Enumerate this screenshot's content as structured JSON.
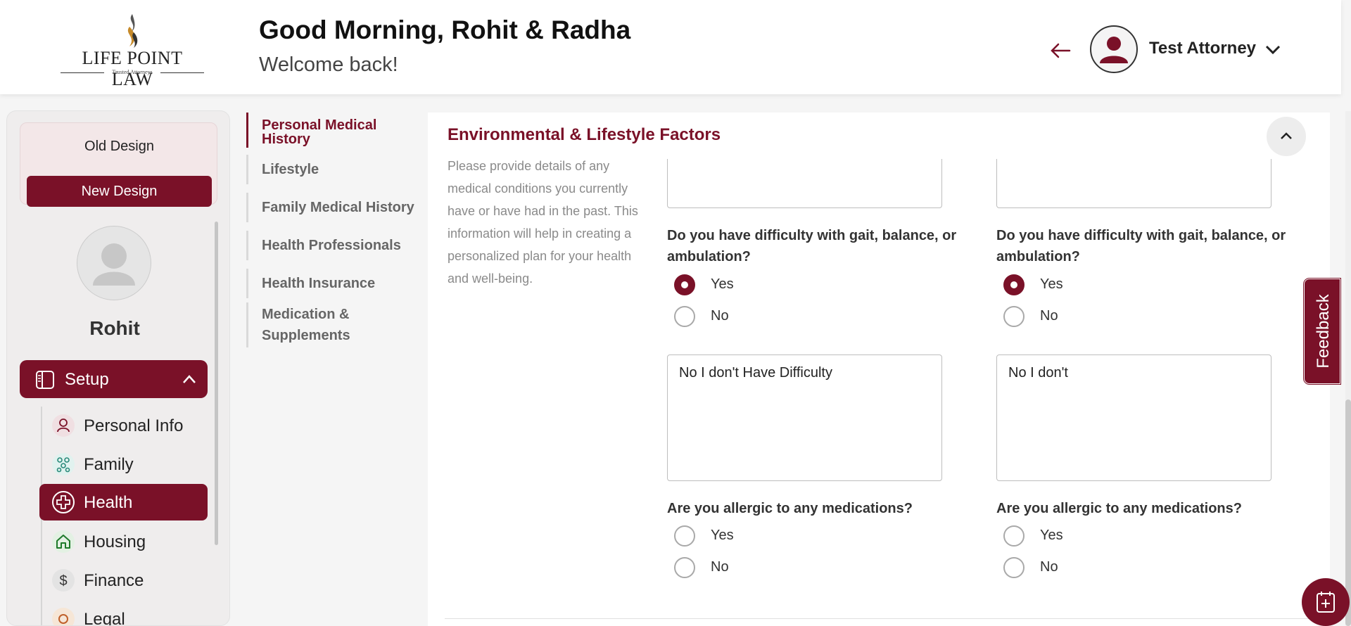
{
  "header": {
    "logo_text": "LIFE POINT LAW",
    "logo_tagline": "Trusted Attorneys",
    "greeting": "Good Morning, Rohit & Radha",
    "welcome": "Welcome back!",
    "user_name": "Test Attorney"
  },
  "sidebar": {
    "old_design": "Old Design",
    "new_design": "New Design",
    "profile_name": "Rohit",
    "setup_label": "Setup",
    "items": [
      {
        "label": "Personal Info",
        "icon": "person-icon"
      },
      {
        "label": "Family",
        "icon": "family-icon"
      },
      {
        "label": "Health",
        "icon": "health-plus-icon",
        "active": true
      },
      {
        "label": "Housing",
        "icon": "home-icon"
      },
      {
        "label": "Finance",
        "icon": "dollar-icon"
      },
      {
        "label": "Legal",
        "icon": "legal-icon"
      }
    ]
  },
  "subnav": {
    "items": [
      {
        "label": "Personal Medical History",
        "active": true
      },
      {
        "label": "Lifestyle"
      },
      {
        "label": "Family Medical History"
      },
      {
        "label": "Health Professionals"
      },
      {
        "label": "Health Insurance"
      },
      {
        "label": "Medication & Supplements"
      }
    ]
  },
  "panel": {
    "title": "Environmental & Lifestyle Factors",
    "description": "Please provide details of any medical conditions you currently have or have had in the past. This information will help in creating a personalized plan for your health and well-being.",
    "columns": [
      {
        "gait_question": "Do you have difficulty with gait, balance, or ambulation?",
        "gait_options": [
          "Yes",
          "No"
        ],
        "gait_selected": "Yes",
        "gait_details": "No I don't Have Difficulty",
        "allergy_question": "Are you allergic to any medications?",
        "allergy_options": [
          "Yes",
          "No"
        ],
        "allergy_selected": null
      },
      {
        "gait_question": "Do you have difficulty with gait, balance, or ambulation?",
        "gait_options": [
          "Yes",
          "No"
        ],
        "gait_selected": "Yes",
        "gait_details": "No I don't",
        "allergy_question": "Are you allergic to any medications?",
        "allergy_options": [
          "Yes",
          "No"
        ],
        "allergy_selected": null
      }
    ]
  },
  "feedback_label": "Feedback",
  "colors": {
    "brand": "#7a1128",
    "panel_bg": "#ffffff",
    "page_bg": "#f5f5f5"
  }
}
